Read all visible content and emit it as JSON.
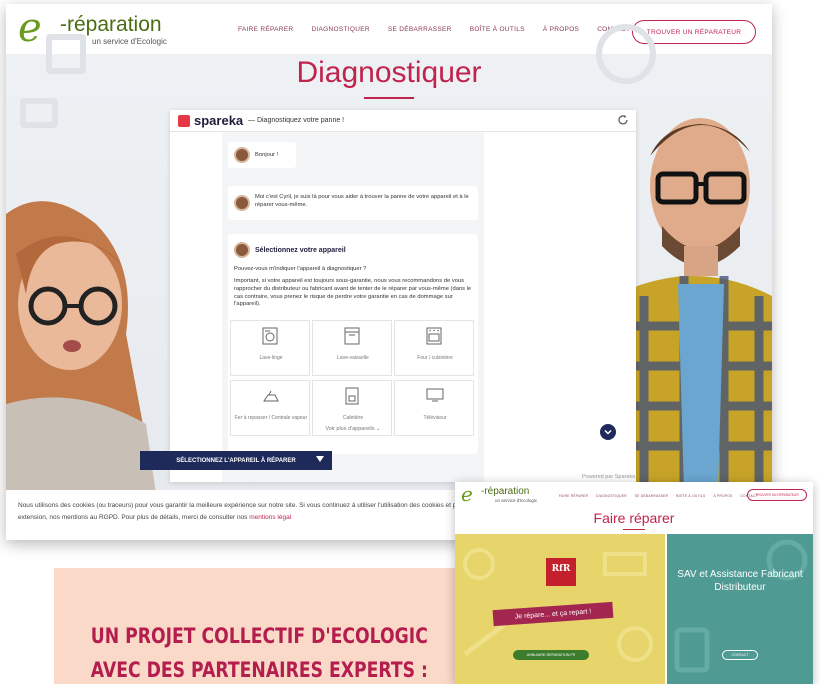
{
  "colors": {
    "brand_red": "#c0244d",
    "brand_green": "#6a9a1f",
    "navy": "#1e2a5a",
    "banner_bg": "#fbd9c8",
    "banner_text": "#b41e4e",
    "panel_yellow": "#e7d46a",
    "panel_teal": "#4f9a93"
  },
  "main_site": {
    "logo": {
      "glyph": "e",
      "name": "-réparation",
      "tagline": "un service d'Ecologic"
    },
    "nav": [
      "FAIRE RÉPARER",
      "DIAGNOSTIQUER",
      "SE DÉBARRASSER",
      "BOÎTE À OUTILS",
      "À PROPOS",
      "CONTACT"
    ],
    "cta_label": "TROUVER UN RÉPARATEUR",
    "page_title": "Diagnostiquer"
  },
  "widget": {
    "brand": "spareka",
    "subtitle": "— Diagnostiquez votre panne !",
    "messages": [
      "Bonjour !",
      "Moi c'est Cyril, je suis là pour vous aider à trouver la panne de votre appareil et à le réparer vous-même."
    ],
    "select_card": {
      "title": "Sélectionnez votre appareil",
      "question": "Pouvez-vous m'indiquer l'appareil à diagnostiquer ?",
      "note": "Important, si votre appareil est toujours sous-garantie, nous vous recommandons de vous rapprocher du distributeur ou fabricant avant de tenter de le réparer par vous-même (dans le cas contraire, vous prenez le risque de perdre votre garantie en cas de dommage sur l'appareil)."
    },
    "appliances": [
      {
        "label": "Lave-linge",
        "icon": "washing-machine-icon"
      },
      {
        "label": "Lave-vaisselle",
        "icon": "dishwasher-icon"
      },
      {
        "label": "Four / cuisinière",
        "icon": "oven-icon"
      },
      {
        "label": "Fer à repasser / Centrale vapeur",
        "icon": "iron-icon"
      },
      {
        "label": "Cafetière",
        "icon": "coffee-maker-icon"
      },
      {
        "label": "Téléviseur",
        "icon": "tv-icon"
      }
    ],
    "show_more": "Voir plus d'appareils ⌄",
    "select_button": "SÉLECTIONNEZ L'APPAREIL À RÉPARER",
    "powered_by": "Powered par Spareka"
  },
  "cookie": {
    "text": "Nous utilisons des cookies (ou traceurs) pour vous garantir la meilleure expérience sur notre site. Si vous continuez à utiliser l'utilisation des cookies et par extension, nos mentions au RGPD. Pour plus de détails, merci de consulter nos",
    "link": "mentions légal"
  },
  "banner": {
    "line1": "UN PROJET COLLECTIF D'ECOLOGIC",
    "line2": "AVEC DES PARTENAIRES EXPERTS :"
  },
  "second_site": {
    "logo": {
      "glyph": "e",
      "name": "-réparation",
      "tagline": "un service d'Ecologic"
    },
    "nav": [
      "FAIRE RÉPARER",
      "DIAGNOSTIQUER",
      "SE DÉBARRASSER",
      "BOÎTE À OUTILS",
      "À PROPOS",
      "CONTACT"
    ],
    "cta_label": "TROUVER UN RÉPARATEUR",
    "page_title": "Faire réparer",
    "left_panel": {
      "logo_text": "RfR",
      "banner": "Je répare... et ça repart !",
      "button": "ANNUAIRE-REPARATION.FR"
    },
    "right_panel": {
      "title": "SAV et Assistance Fabricant Distributeur",
      "button": "CONTACT"
    }
  }
}
